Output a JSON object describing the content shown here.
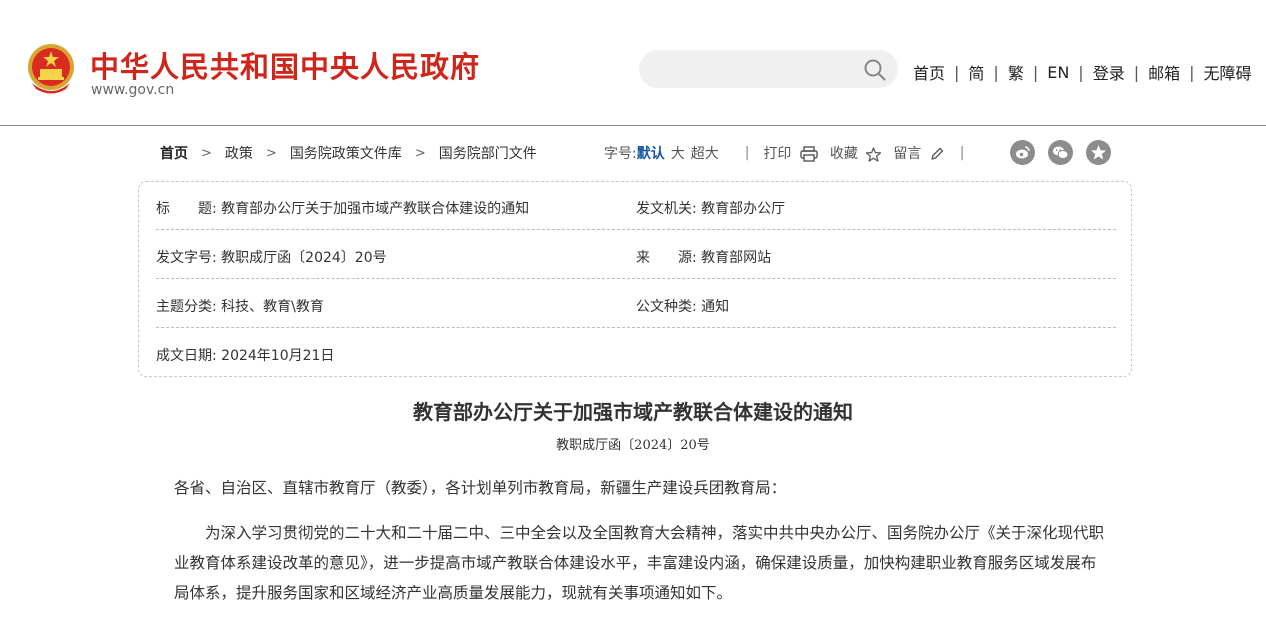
{
  "header": {
    "site_title": "中华人民共和国中央人民政府",
    "site_url": "www.gov.cn",
    "search_placeholder": "",
    "nav": [
      "首页",
      "简",
      "繁",
      "EN",
      "登录",
      "邮箱",
      "无障碍"
    ]
  },
  "breadcrumb": [
    "首页",
    "政策",
    "国务院政策文件库",
    "国务院部门文件"
  ],
  "tools": {
    "font_size_label": "字号:",
    "font_default": "默认",
    "font_large": "大",
    "font_xlarge": "超大",
    "print": "打印",
    "favorite": "收藏",
    "comment": "留言"
  },
  "info": {
    "title_label": "标　　题:",
    "title_value": "教育部办公厅关于加强市域产教联合体建设的通知",
    "issuer_label": "发文机关:",
    "issuer_value": "教育部办公厅",
    "doc_no_label": "发文字号:",
    "doc_no_value": "教职成厅函〔2024〕20号",
    "source_label": "来　　源:",
    "source_value": "教育部网站",
    "topic_label": "主题分类:",
    "topic_value": "科技、教育\\教育",
    "type_label": "公文种类:",
    "type_value": "通知",
    "date_label": "成文日期:",
    "date_value": "2024年10月21日"
  },
  "article": {
    "title": "教育部办公厅关于加强市域产教联合体建设的通知",
    "number": "教职成厅函〔2024〕20号",
    "p1": "各省、自治区、直辖市教育厅（教委），各计划单列市教育局，新疆生产建设兵团教育局：",
    "p2": "为深入学习贯彻党的二十大和二十届二中、三中全会以及全国教育大会精神，落实中共中央办公厅、国务院办公厅《关于深化现代职业教育体系建设改革的意见》，进一步提高市域产教联合体建设水平，丰富建设内涵，确保建设质量，加快构建职业教育服务区域发展布局体系，提升服务国家和区域经济产业高质量发展能力，现就有关事项通知如下。"
  },
  "colors": {
    "brand_red": "#d0251a",
    "active_blue": "#1556a5",
    "icon_gray": "#8c8c8c"
  }
}
